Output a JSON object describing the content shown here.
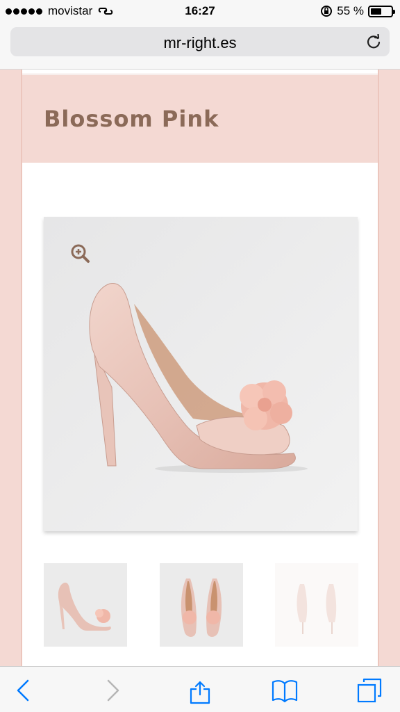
{
  "status": {
    "carrier": "movistar",
    "time": "16:27",
    "battery_percent": "55 %",
    "battery_level": 0.55
  },
  "browser": {
    "url": "mr-right.es"
  },
  "product": {
    "title": "Blossom Pink"
  },
  "colors": {
    "accent": "#007aff",
    "title": "#8b6a58",
    "band": "#f4d9d3"
  },
  "icons": {
    "zoom": "zoom-in-icon",
    "back": "chevron-left-icon",
    "forward": "chevron-right-icon",
    "share": "share-icon",
    "bookmarks": "book-icon",
    "tabs": "tabs-icon"
  }
}
